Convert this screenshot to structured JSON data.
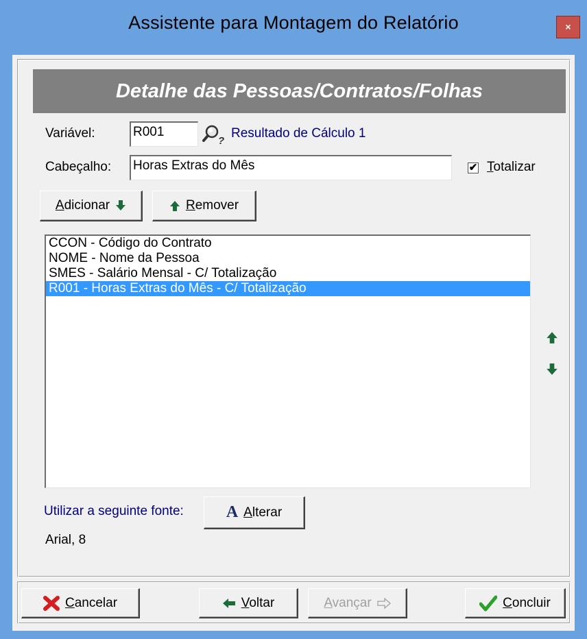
{
  "window": {
    "title": "Assistente para Montagem do Relatório",
    "close_label": "×"
  },
  "banner": {
    "title": "Detalhe das Pessoas/Contratos/Folhas"
  },
  "variable": {
    "label": "Variável:",
    "value": "R001",
    "description": "Resultado de Cálculo 1"
  },
  "header_field": {
    "label": "Cabeçalho:",
    "value": "Horas Extras do Mês"
  },
  "totalizar": {
    "label_first": "T",
    "label_rest": "otalizar",
    "checked": true,
    "mark": "✔"
  },
  "buttons": {
    "add_first": "A",
    "add_rest": "dicionar",
    "remove_first": "R",
    "remove_rest": "emover"
  },
  "list": {
    "items": [
      "CCON - Código do Contrato",
      "NOME - Nome da Pessoa",
      "SMES - Salário Mensal - C/ Totalização",
      "R001 - Horas Extras do Mês - C/ Totalização"
    ],
    "selected_index": 3
  },
  "font_section": {
    "label": "Utilizar a seguinte fonte:",
    "button_first": "A",
    "button_rest": "lterar",
    "button_glyph": "A",
    "current_font": "Arial, 8"
  },
  "footer": {
    "cancel_first": "C",
    "cancel_rest": "ancelar",
    "back_first": "V",
    "back_rest": "oltar",
    "next_first": "A",
    "next_rest": "vançar",
    "finish_first": "C",
    "finish_rest": "oncluir"
  },
  "colors": {
    "title_bar": "#6aa2e0",
    "banner": "#808080",
    "selection": "#3399ff",
    "arrow_green": "#1d6b3a",
    "accent_blue": "#00007c"
  }
}
